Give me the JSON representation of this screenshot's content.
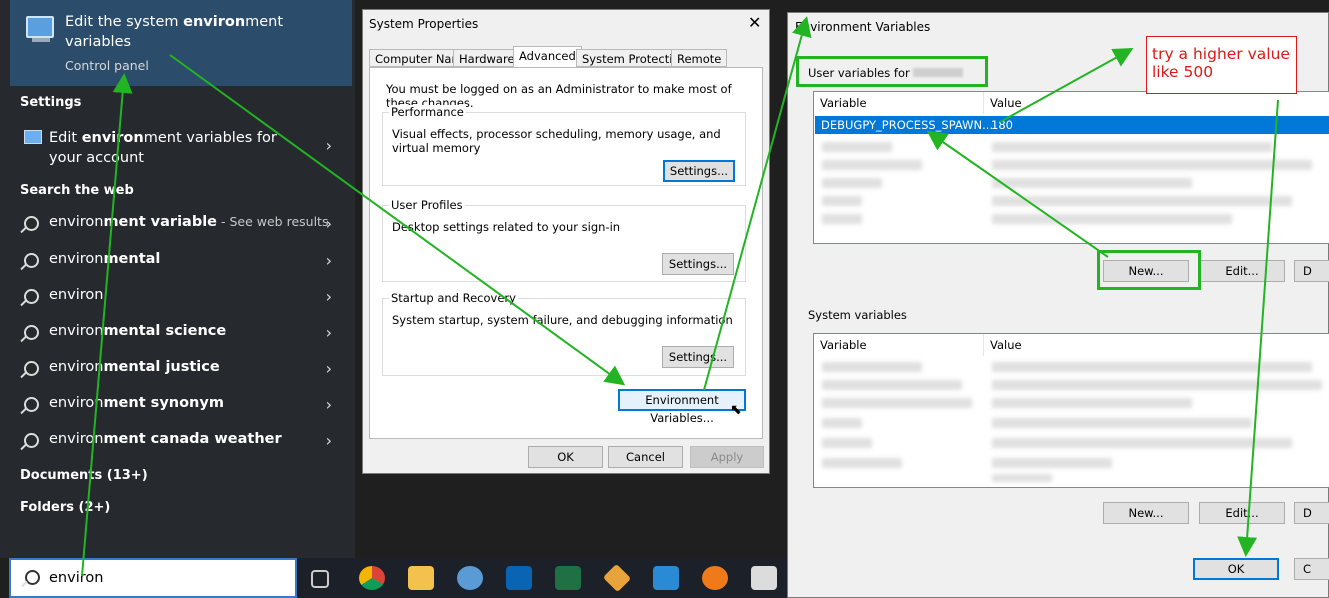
{
  "start_menu": {
    "best_match": {
      "title_pre": "Edit the system ",
      "title_bold": "environ",
      "title_post": "ment variables",
      "subtitle": "Control panel"
    },
    "settings_header": "Settings",
    "settings_item": {
      "pre": "Edit ",
      "bold": "environ",
      "post": "ment variables for your account"
    },
    "web_header": "Search the web",
    "web_items": [
      {
        "pre": "environ",
        "bold": "ment variable",
        "suffix": " - See web results"
      },
      {
        "pre": "environ",
        "bold": "mental",
        "suffix": ""
      },
      {
        "pre": "environ",
        "bold": "",
        "suffix": ""
      },
      {
        "pre": "environ",
        "bold": "mental science",
        "suffix": ""
      },
      {
        "pre": "environ",
        "bold": "mental justice",
        "suffix": ""
      },
      {
        "pre": "environ",
        "bold": "ment synonym",
        "suffix": ""
      },
      {
        "pre": "environ",
        "bold": "ment canada weather",
        "suffix": ""
      }
    ],
    "documents": "Documents (13+)",
    "folders": "Folders (2+)",
    "search_value": "environ"
  },
  "system_properties": {
    "title": "System Properties",
    "tabs": [
      "Computer Name",
      "Hardware",
      "Advanced",
      "System Protection",
      "Remote"
    ],
    "admin_note": "You must be logged on as an Administrator to make most of these changes.",
    "performance": {
      "label": "Performance",
      "text": "Visual effects, processor scheduling, memory usage, and virtual memory",
      "button": "Settings..."
    },
    "profiles": {
      "label": "User Profiles",
      "text": "Desktop settings related to your sign-in",
      "button": "Settings..."
    },
    "startup": {
      "label": "Startup and Recovery",
      "text": "System startup, system failure, and debugging information",
      "button": "Settings..."
    },
    "env_button": "Environment Variables...",
    "ok": "OK",
    "cancel": "Cancel",
    "apply": "Apply"
  },
  "env_vars": {
    "title": "Environment Variables",
    "user_label": "User variables for",
    "col_variable": "Variable",
    "col_value": "Value",
    "selected_row": {
      "variable": "DEBUGPY_PROCESS_SPAWN...",
      "value": "180"
    },
    "new": "New...",
    "edit": "Edit...",
    "delete": "D",
    "system_label": "System variables",
    "ok": "OK",
    "cancel": "C"
  },
  "annotation": {
    "note": "try a higher value like 500"
  },
  "colors": {
    "annotation_green": "#22b422",
    "note_red": "#e01818",
    "selection_blue": "#0078d7",
    "startmenu_bg": "#262a2f"
  }
}
